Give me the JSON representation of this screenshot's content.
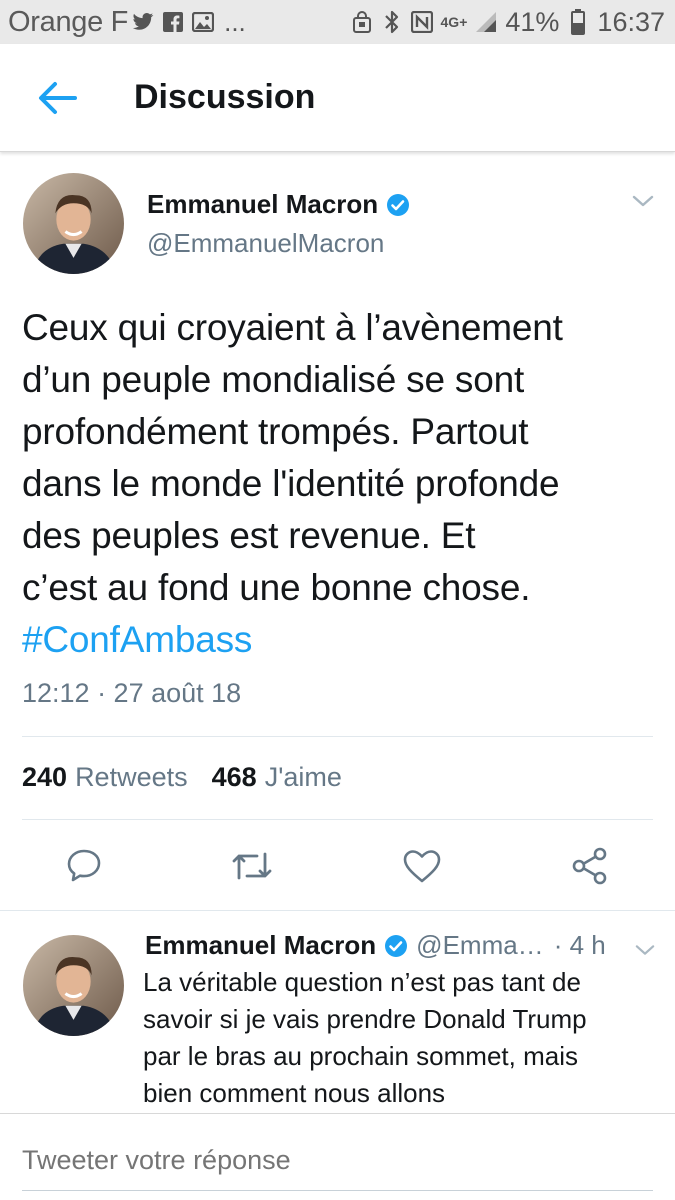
{
  "status_bar": {
    "carrier": "Orange F",
    "ellipsis": "...",
    "network": "4G+",
    "battery": "41%",
    "time": "16:37",
    "icons_left": [
      "twitter-icon",
      "facebook-icon",
      "image-icon"
    ],
    "icons_right": [
      "lock-icon",
      "bluetooth-icon",
      "nfc-icon",
      "signal-icon",
      "battery-icon"
    ]
  },
  "appbar": {
    "title": "Discussion",
    "accent": "#1da1f2"
  },
  "main_tweet": {
    "author": "Emmanuel Macron",
    "handle": "@EmmanuelMacron",
    "verified": true,
    "text_lines": [
      "Ceux qui croyaient à l’avènement",
      "d’un peuple mondialisé se sont",
      "profondément trompés. Partout",
      "dans le monde l'identité profonde",
      "des peuples est revenue. Et",
      "c’est au fond une bonne chose."
    ],
    "hashtag": "#ConfAmbass",
    "timestamp": "12:12 · 27 août 18",
    "retweets_count": "240",
    "retweets_label": "Retweets",
    "likes_count": "468",
    "likes_label": "J'aime",
    "actions": [
      "reply-icon",
      "retweet-icon",
      "like-icon",
      "share-icon"
    ]
  },
  "reply_tweet": {
    "author": "Emmanuel Macron",
    "handle": "@Emma…",
    "time": "· 4 h",
    "verified": true,
    "text_lines": [
      "La véritable question n’est pas tant de",
      "savoir si je vais prendre Donald  Trump",
      "par le bras au prochain sommet, mais",
      "bien comment nous allons"
    ]
  },
  "compose": {
    "placeholder": "Tweeter votre réponse"
  },
  "colors": {
    "text": "#14171a",
    "secondary": "#657786",
    "link": "#1da1f2",
    "divider": "#e1e8ed"
  }
}
